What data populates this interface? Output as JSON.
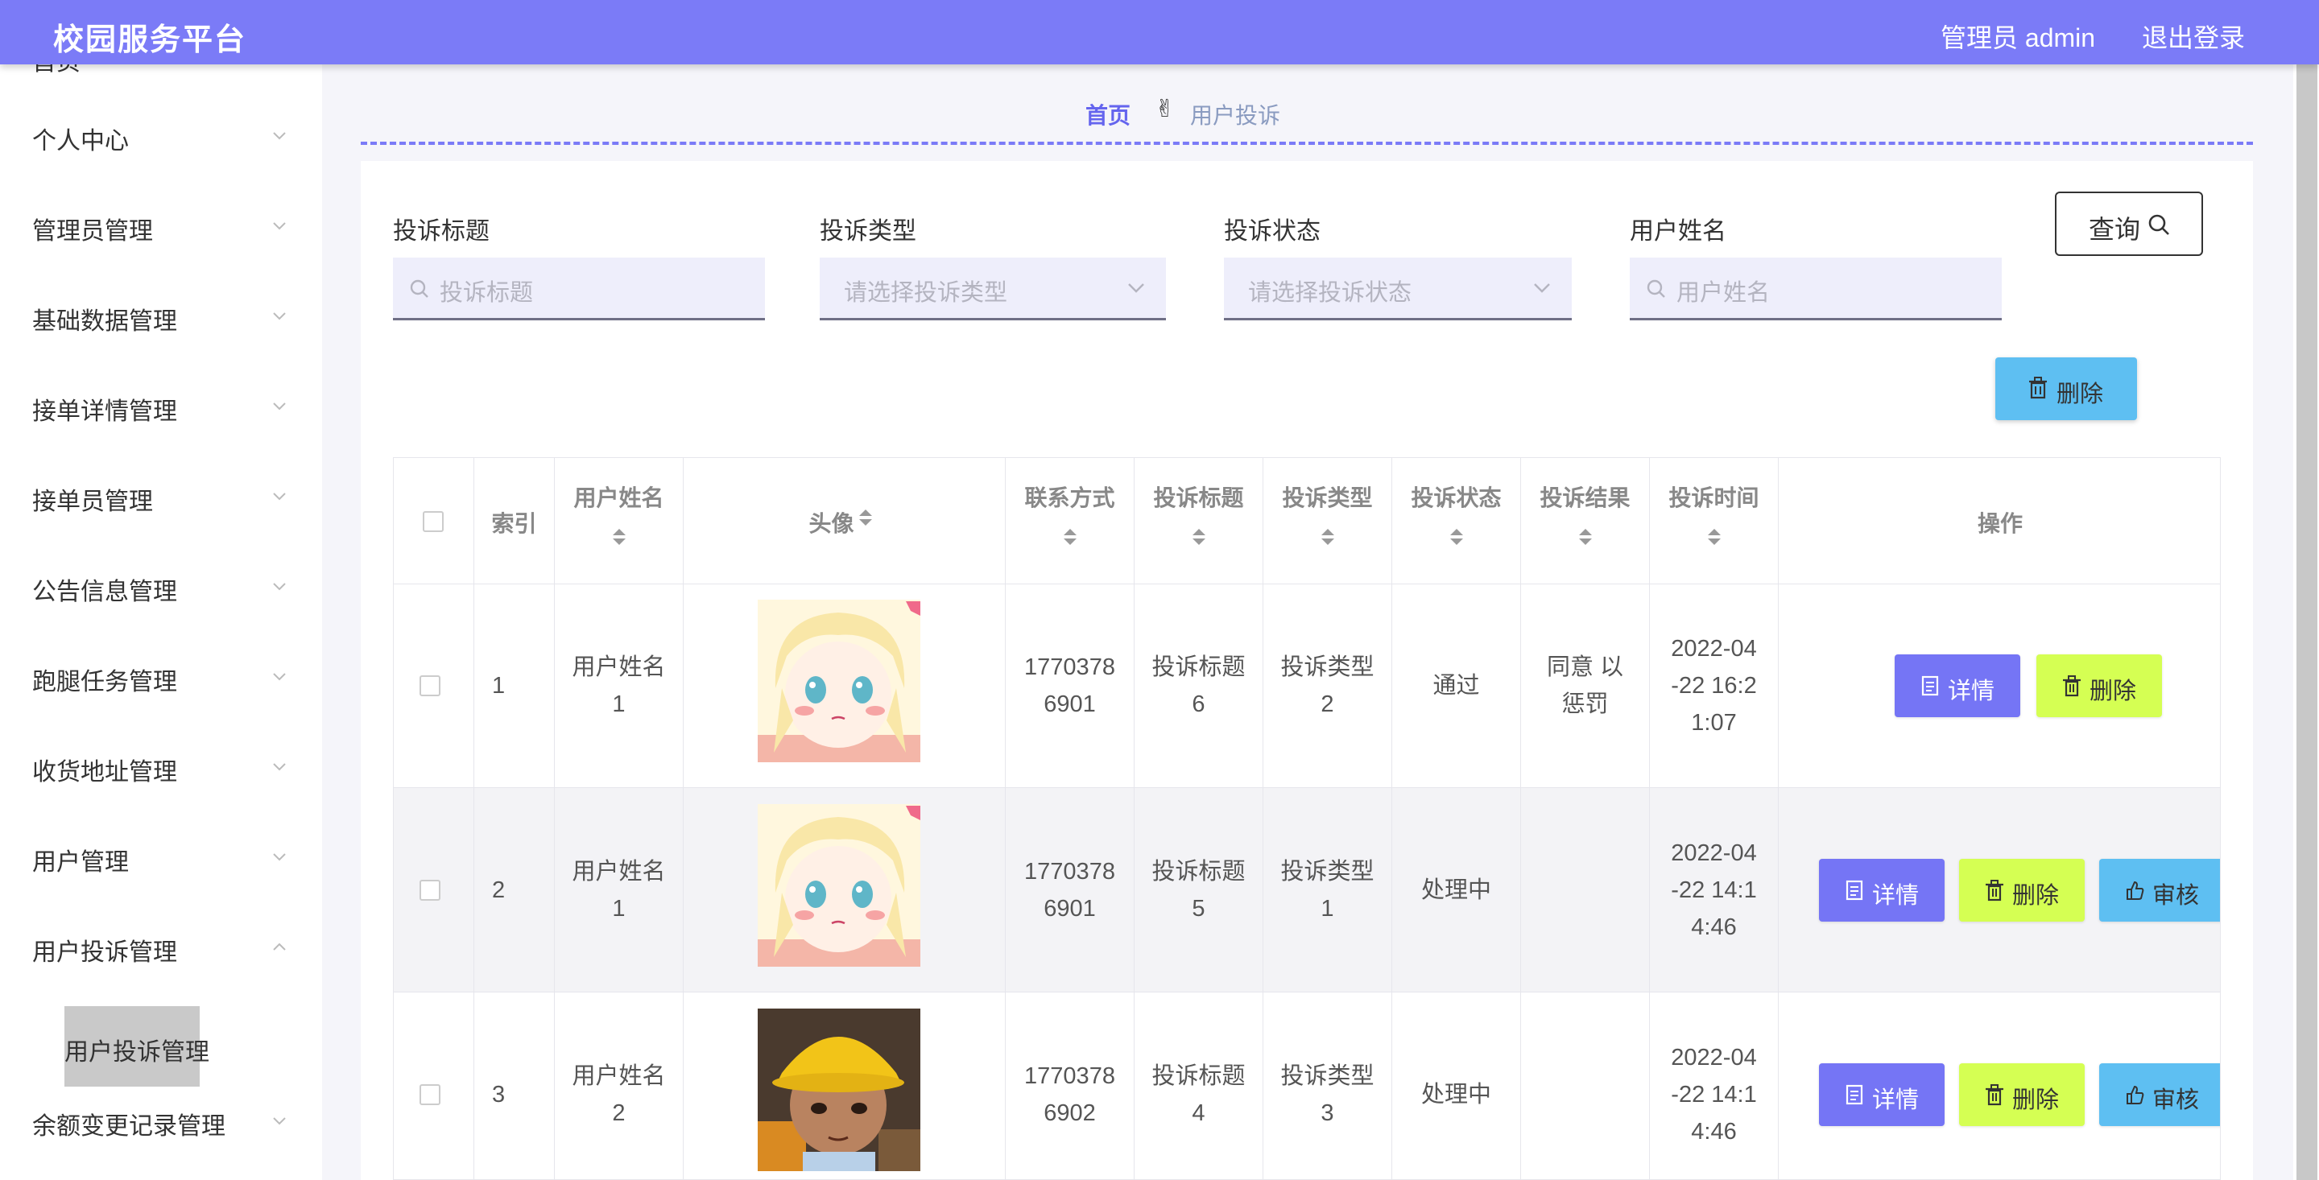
{
  "header": {
    "brand": "校园服务平台",
    "admin": "管理员 admin",
    "logout": "退出登录"
  },
  "sidebar": {
    "cut_item": "首页",
    "items": [
      {
        "label": "个人中心"
      },
      {
        "label": "管理员管理"
      },
      {
        "label": "基础数据管理"
      },
      {
        "label": "接单详情管理"
      },
      {
        "label": "接单员管理"
      },
      {
        "label": "公告信息管理"
      },
      {
        "label": "跑腿任务管理"
      },
      {
        "label": "收货地址管理"
      },
      {
        "label": "用户管理"
      },
      {
        "label": "用户投诉管理",
        "expanded": true
      },
      {
        "label": "余额变更记录管理"
      }
    ],
    "sub_item": "用户投诉管理"
  },
  "breadcrumb": {
    "home": "首页",
    "icon": "✌",
    "current": "用户投诉"
  },
  "filters": {
    "title_label": "投诉标题",
    "title_placeholder": "投诉标题",
    "type_label": "投诉类型",
    "type_placeholder": "请选择投诉类型",
    "status_label": "投诉状态",
    "status_placeholder": "请选择投诉状态",
    "user_label": "用户姓名",
    "user_placeholder": "用户姓名",
    "query_label": "查询"
  },
  "delete_button": "删除",
  "table": {
    "headers": [
      "索引",
      "用户姓名",
      "头像",
      "联系方式",
      "投诉标题",
      "投诉类型",
      "投诉状态",
      "投诉结果",
      "投诉时间",
      "操作"
    ],
    "rows": [
      {
        "index": "1",
        "user": [
          "用户姓名",
          "1"
        ],
        "avatar": "blonde-anime-girl",
        "phone": [
          "1770378",
          "6901"
        ],
        "title": [
          "投诉标题",
          "6"
        ],
        "type": [
          "投诉类型",
          "2"
        ],
        "status": "通过",
        "result": [
          "同意 以",
          "惩罚"
        ],
        "time": [
          "2022-04",
          "-22 16:2",
          "1:07"
        ],
        "actions": [
          "详情",
          "删除"
        ]
      },
      {
        "index": "2",
        "user": [
          "用户姓名",
          "1"
        ],
        "avatar": "blonde-anime-girl",
        "phone": [
          "1770378",
          "6901"
        ],
        "title": [
          "投诉标题",
          "5"
        ],
        "type": [
          "投诉类型",
          "1"
        ],
        "status": "处理中",
        "result": [
          "",
          ""
        ],
        "time": [
          "2022-04",
          "-22 14:1",
          "4:46"
        ],
        "actions": [
          "详情",
          "删除",
          "审核"
        ]
      },
      {
        "index": "3",
        "user": [
          "用户姓名",
          "2"
        ],
        "avatar": "boy-yellow-hat",
        "phone": [
          "1770378",
          "6902"
        ],
        "title": [
          "投诉标题",
          "4"
        ],
        "type": [
          "投诉类型",
          "3"
        ],
        "status": "处理中",
        "result": [
          "",
          ""
        ],
        "time": [
          "2022-04",
          "-22 14:1",
          "4:46"
        ],
        "actions": [
          "详情",
          "删除",
          "审核"
        ]
      }
    ]
  },
  "colors": {
    "primary": "#7b7bf7",
    "danger_btn": "#d5ff53",
    "info_btn": "#5ebff2"
  }
}
